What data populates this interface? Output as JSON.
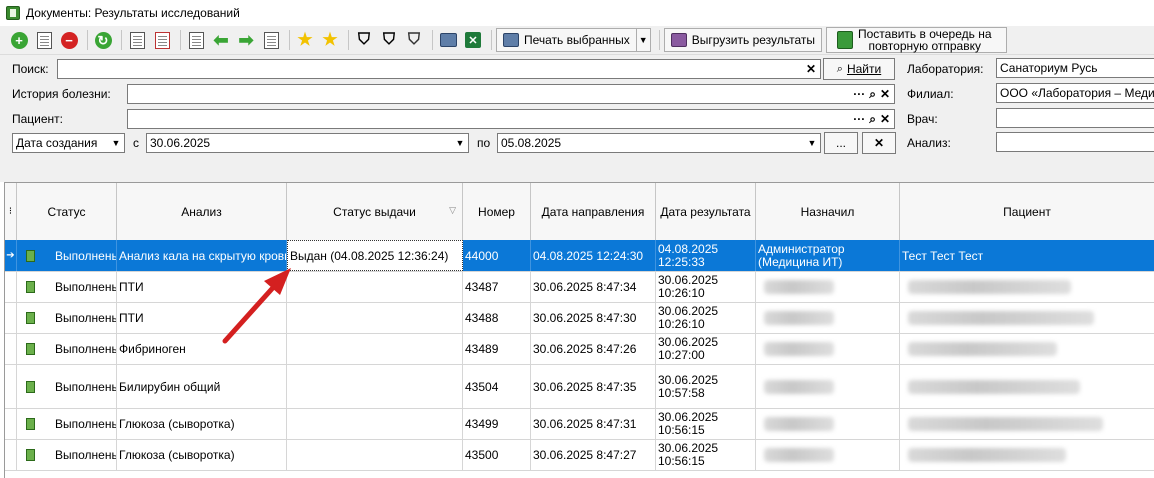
{
  "window": {
    "title": "Документы: Результаты исследований"
  },
  "toolbar": {
    "print_selected": "Печать выбранных",
    "export_results": "Выгрузить результаты",
    "queue_line1": "Поставить в очередь на",
    "queue_line2": "повторную отправку"
  },
  "filters": {
    "search_label": "Поиск:",
    "search_value": "",
    "find_button": "Найти",
    "history_label": "История болезни:",
    "patient_label": "Пациент:",
    "date_type": "Дата создания",
    "from_label": "с",
    "from_date": "30.06.2025",
    "to_label": "по",
    "to_date": "05.08.2025",
    "dots_button": "...",
    "lab_label": "Лаборатория:",
    "lab_value": "Санаториум Русь",
    "branch_label": "Филиал:",
    "branch_value": "ООО «Лаборатория – Меди",
    "doctor_label": "Врач:",
    "analysis_label": "Анализ:"
  },
  "grid": {
    "columns": [
      "Статус",
      "Анализ",
      "Статус выдачи",
      "Номер",
      "Дата направления",
      "Дата результата",
      "Назначил",
      "Пациент"
    ],
    "rows": [
      {
        "status": "Выполнены",
        "analysis": "Анализ кала на скрытую кровь",
        "issue_status": "Выдан (04.08.2025 12:36:24)",
        "number": "44000",
        "sent_date": "04.08.2025 12:24:30",
        "result_date_1": "04.08.2025",
        "result_date_2": "12:25:33",
        "assigned_by": "Администратор (Медицина ИТ)",
        "patient": "Тест Тест Тест"
      },
      {
        "status": "Выполнены",
        "analysis": "ПТИ",
        "issue_status": "",
        "number": "43487",
        "sent_date": "30.06.2025 8:47:34",
        "result_date_1": "30.06.2025",
        "result_date_2": "10:26:10",
        "assigned_by": "",
        "patient": ""
      },
      {
        "status": "Выполнены",
        "analysis": "ПТИ",
        "issue_status": "",
        "number": "43488",
        "sent_date": "30.06.2025 8:47:30",
        "result_date_1": "30.06.2025",
        "result_date_2": "10:26:10",
        "assigned_by": "",
        "patient": ""
      },
      {
        "status": "Выполнены",
        "analysis": "Фибриноген",
        "issue_status": "",
        "number": "43489",
        "sent_date": "30.06.2025 8:47:26",
        "result_date_1": "30.06.2025",
        "result_date_2": "10:27:00",
        "assigned_by": "",
        "patient": ""
      },
      {
        "status": "Выполнены",
        "analysis": "Билирубин общий",
        "issue_status": "",
        "number": "43504",
        "sent_date": "30.06.2025 8:47:35",
        "result_date_1": "30.06.2025",
        "result_date_2": "10:57:58",
        "assigned_by": "",
        "patient": ""
      },
      {
        "status": "Выполнены",
        "analysis": "Глюкоза (сыворотка)",
        "issue_status": "",
        "number": "43499",
        "sent_date": "30.06.2025 8:47:31",
        "result_date_1": "30.06.2025",
        "result_date_2": "10:56:15",
        "assigned_by": "",
        "patient": ""
      },
      {
        "status": "Выполнены",
        "analysis": "Глюкоза (сыворотка)",
        "issue_status": "",
        "number": "43500",
        "sent_date": "30.06.2025 8:47:27",
        "result_date_1": "30.06.2025",
        "result_date_2": "10:56:15",
        "assigned_by": "",
        "patient": ""
      }
    ]
  },
  "colors": {
    "selection": "#0b78d7",
    "annotation_arrow": "#d42020"
  }
}
